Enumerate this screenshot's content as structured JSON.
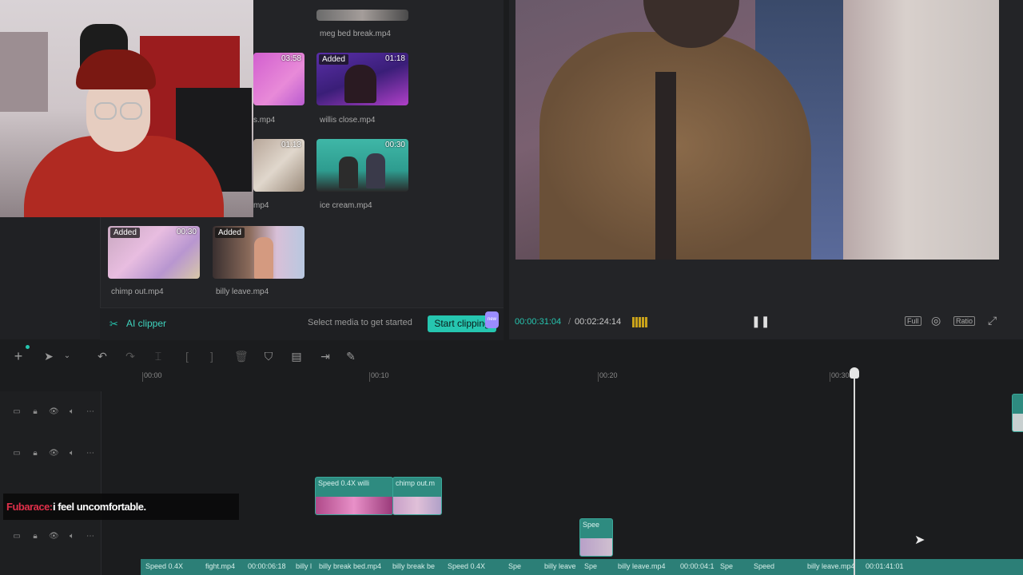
{
  "media": {
    "items": [
      {
        "name": "meg bed break.mp4",
        "duration": "",
        "added": false
      },
      {
        "name": "s.mp4",
        "duration": "03:58",
        "added": false
      },
      {
        "name": "willis close.mp4",
        "duration": "01:18",
        "added": true
      },
      {
        "name": "mp4",
        "duration": "01:13",
        "added": false
      },
      {
        "name": "ice cream.mp4",
        "duration": "00:30",
        "added": false
      },
      {
        "name": "chimp out.mp4",
        "duration": "00:30",
        "added": true
      },
      {
        "name": "billy leave.mp4",
        "duration": "",
        "added": true
      }
    ],
    "added_label": "Added",
    "ai_clipper_label": "AI clipper",
    "hint": "Select media to get started",
    "start_clipping_label": "Start clipping",
    "new_tag": "new"
  },
  "preview": {
    "current_time": "00:00:31:04",
    "total_time": "00:02:24:14",
    "full_label": "Full",
    "ratio_label": "Ratio"
  },
  "timeline": {
    "ruler_labels": [
      "00:00",
      "00:10",
      "00:20",
      "00:30"
    ],
    "clips": [
      {
        "label": "Speed 0.4X  willi"
      },
      {
        "label": "chimp out.m"
      },
      {
        "label": "Spee"
      }
    ],
    "bottom_strip_labels": [
      "Speed 0.4X",
      "fight.mp4",
      "00:00:06:18",
      "billy l",
      "billy break bed.mp4",
      "billy break be",
      "Speed 0.4X",
      "Spe",
      "billy leave",
      "Spe",
      "billy leave.mp4",
      "00:00:04:1",
      "Spe",
      "Speed",
      "billy leave.mp4",
      "00:01:41:01"
    ]
  },
  "chat": {
    "user": "Fubarace:",
    "message": "i feel uncomfortable.",
    "user_color": "#e0304a"
  },
  "colors": {
    "accent": "#26c6b0",
    "clip": "#2e8b80"
  }
}
